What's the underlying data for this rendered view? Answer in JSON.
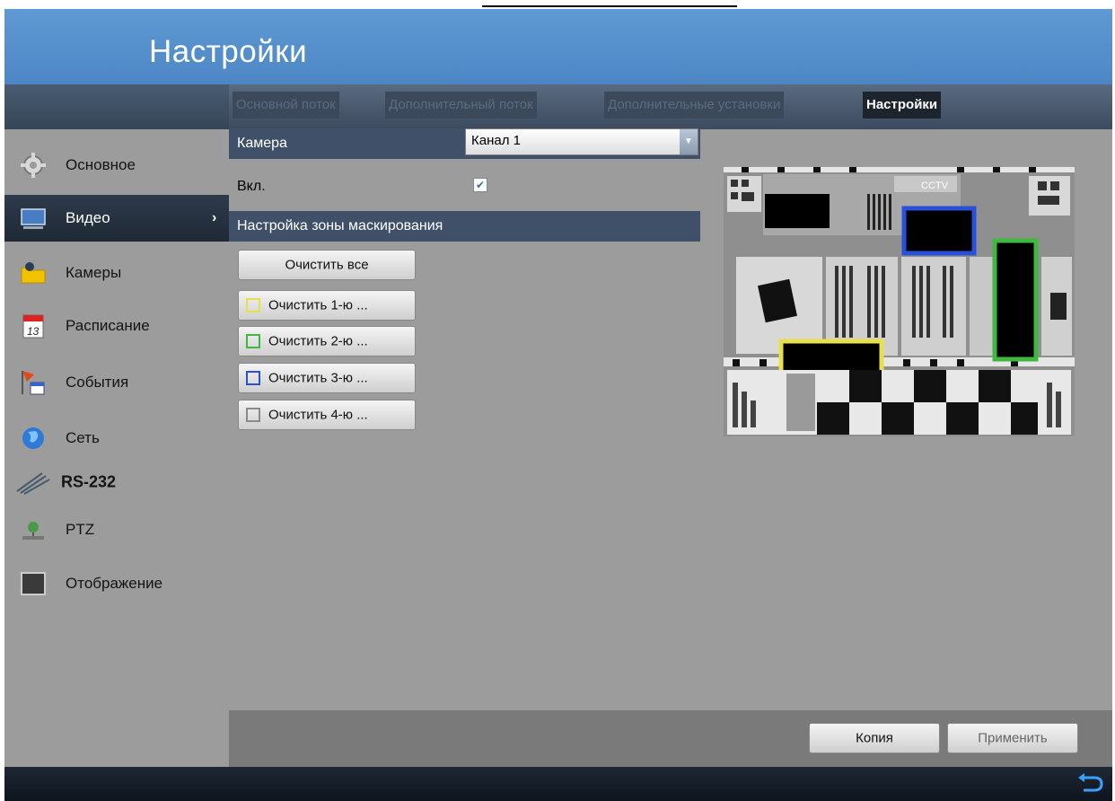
{
  "header": {
    "title": "Настройки"
  },
  "sidebar": {
    "items": [
      {
        "label": "Основное",
        "icon": "gear-icon"
      },
      {
        "label": "Видео",
        "icon": "monitor-icon"
      },
      {
        "label": "Камеры",
        "icon": "folder-icon"
      },
      {
        "label": "Расписание",
        "icon": "calendar-icon"
      },
      {
        "label": "События",
        "icon": "events-flag-icon"
      },
      {
        "label": "Сеть",
        "icon": "globe-icon"
      },
      {
        "label": "RS-232",
        "icon": "cable-icon"
      },
      {
        "label": "PTZ",
        "icon": "ptz-icon"
      },
      {
        "label": "Отображение",
        "icon": "display-icon"
      }
    ],
    "active": "Видео"
  },
  "tabs": [
    "Основной поток",
    "Дополнительный поток",
    "Дополнительные установки",
    "Настройки"
  ],
  "active_tab": "Настройки",
  "form": {
    "camera_label": "Камера",
    "camera_value": "Канал 1",
    "enable_label": "Вкл.",
    "enable_checked": true,
    "mask_section_label": "Настройка зоны маскирования",
    "clear_all_label": "Очистить все",
    "clear_zone_buttons": [
      {
        "label": "Очистить 1-ю ...",
        "color": "#e8e04a"
      },
      {
        "label": "Очистить 2-ю ...",
        "color": "#3fb83f"
      },
      {
        "label": "Очистить 3-ю ...",
        "color": "#2a4fd8"
      },
      {
        "label": "Очистить 4-ю ...",
        "color": "#8a8a8a"
      }
    ]
  },
  "preview": {
    "overlay_text": "CCTV"
  },
  "footer": {
    "copy_label": "Копия",
    "apply_label": "Применить"
  },
  "colors": {
    "header": "#5a94d0",
    "panel": "#9c9c9c",
    "mask_zone_1": "#e8e04a",
    "mask_zone_2": "#3fb83f",
    "mask_zone_3": "#2a4fd8"
  }
}
